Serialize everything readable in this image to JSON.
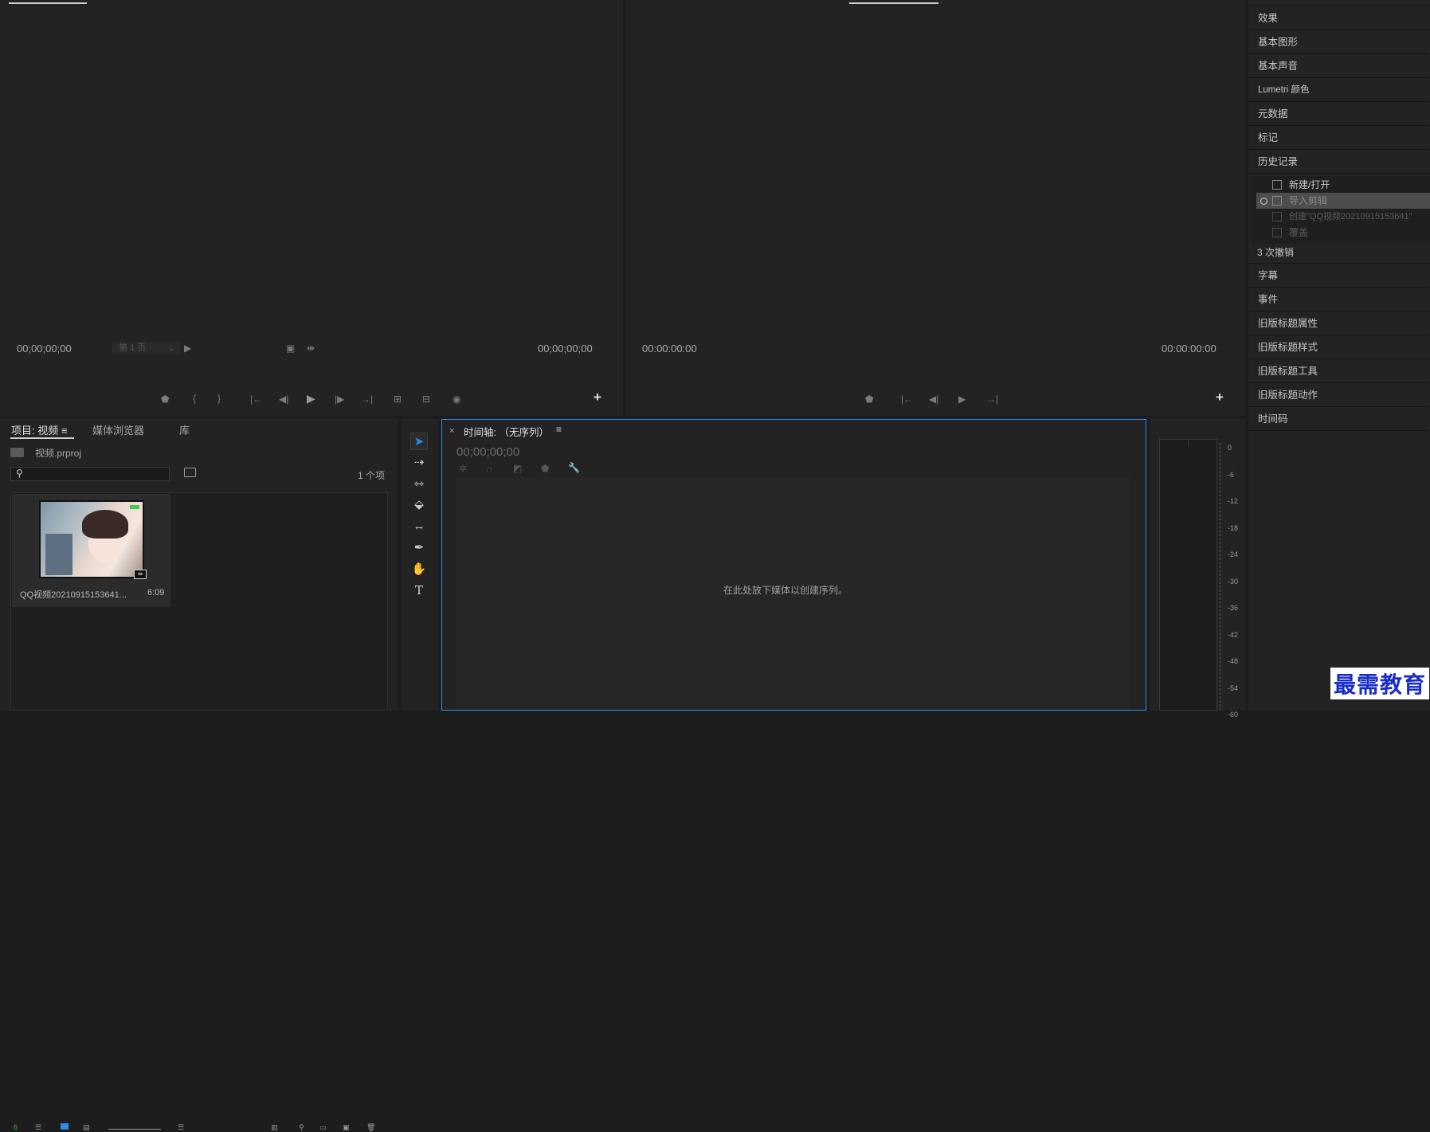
{
  "source_monitor": {
    "tc_left": "00;00;00;00",
    "page": "第 1 页",
    "tc_right": "00;00;00;00"
  },
  "program_monitor": {
    "tc_left": "00:00:00:00",
    "tc_right": "00:00:00:00"
  },
  "controls": {
    "marker": "⬟",
    "in": "{",
    "out": "}",
    "go_in": "|←",
    "step_back": "◀|",
    "play": "▶",
    "step_fwd": "|▶",
    "go_out": "→|",
    "insert": "⊞",
    "overwrite": "⊟",
    "export": "◉",
    "add": "+",
    "lift": "⇧",
    "extract": "⇩"
  },
  "right_panel": {
    "items_top": [
      "效果",
      "基本图形",
      "基本声音",
      "Lumetri 颜色",
      "元数据",
      "标记",
      "历史记录"
    ],
    "history": [
      "新建/打开",
      "导入剪辑",
      "创建\"QQ视频20210915153641\"",
      "覆盖"
    ],
    "undo": "3 次撤销",
    "items_bottom": [
      "字幕",
      "事件",
      "旧版标题属性",
      "旧版标题样式",
      "旧版标题工具",
      "旧版标题动作",
      "时间码"
    ]
  },
  "project": {
    "tabs": [
      "项目: 视频",
      "媒体浏览器",
      "库"
    ],
    "menu_icon": "≡",
    "file": "视频.prproj",
    "count": "1 个项",
    "search_placeholder": "",
    "clip_name": "QQ视频20210915153641...",
    "clip_duration": "6:09"
  },
  "timeline": {
    "close": "×",
    "title": "时间轴: （无序列）",
    "menu_icon": "≡",
    "timecode": "00;00;00;00",
    "empty_msg": "在此处放下媒体以创建序列。"
  },
  "meter": {
    "ticks": [
      "0",
      "-6",
      "-12",
      "-18",
      "-24",
      "-30",
      "-36",
      "-42",
      "-48",
      "-54",
      "-60"
    ]
  },
  "watermark": "最需教育",
  "colors": {
    "accent": "#2d8ceb",
    "panel": "#232323",
    "bg": "#1d1d1d",
    "watermark": "#1a2cc8"
  }
}
